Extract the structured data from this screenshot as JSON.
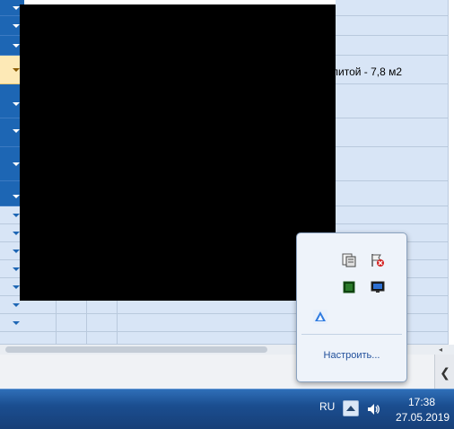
{
  "grid": {
    "visible_cell_text": "р литой - 7,8 м2"
  },
  "tray_flyout": {
    "icons": [
      "network-monitor-icon",
      "flag-error-icon",
      "green-chip-icon",
      "monitor-screen-icon",
      "cloud-drive-icon"
    ],
    "customize_label": "Настроить..."
  },
  "taskbar": {
    "language": "RU",
    "time": "17:38",
    "date": "27.05.2019"
  },
  "colors": {
    "row_header": "#1d66b4",
    "selected_row": "#fde9b6",
    "cell_fill": "#d8e5f6",
    "taskbar": "#1b4e90",
    "link": "#1f4e9a"
  }
}
